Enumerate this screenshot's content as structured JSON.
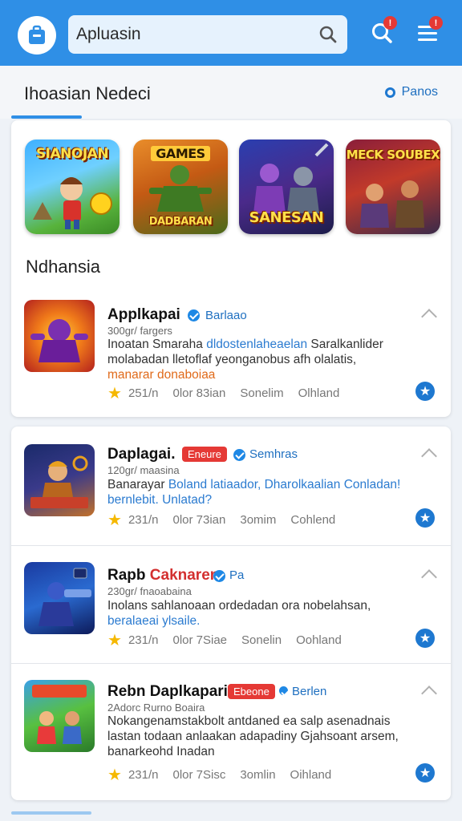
{
  "header": {
    "search_value": "Apluasin",
    "notification_badge": "!",
    "menu_badge": "!"
  },
  "section": {
    "title": "Ihoasian Nedeci",
    "link_label": "Panos",
    "subtitle": "Ndhansia"
  },
  "featured": [
    {
      "label": "SIANOJAN",
      "icon": "hero-game-art"
    },
    {
      "label": "GAMES",
      "icon": "soldier-game-art",
      "label2": "DADBARAN"
    },
    {
      "label": "SANESAN",
      "icon": "knights-game-art"
    },
    {
      "label": "MECK SOUBEX",
      "icon": "warriors-game-art"
    }
  ],
  "apps": [
    {
      "name": "Applkapai",
      "tag": "Barlaao",
      "pill": "",
      "meta": "300gr/ fargers",
      "desc_plain": "Inoatan Smaraha ",
      "desc_accent": "dldostenlaheaelan",
      "desc_rest": " Saralkanlider molabadan lletoflaf yeonganobus afh olalatis,",
      "desc_orange": "manarar donaboiaa",
      "rating": "251/n",
      "stat2": "0lor 83ian",
      "stat3": "Sonelim",
      "stat4": "Olhland"
    },
    {
      "name": "Daplagai.",
      "tag": "Semhras",
      "pill": "Eneure",
      "meta": "120gr/ maasina",
      "desc_plain": "Banarayar ",
      "desc_accent": "Boland latiaador, Dharolkaalian Conladan! bernlebit. Unlatad?",
      "desc_rest": "",
      "desc_orange": "",
      "rating": "231/n",
      "stat2": "0lor 73ian",
      "stat3": "3omim",
      "stat4": "Cohlend"
    },
    {
      "name": "Rapb",
      "name_red": "Caknaren",
      "tag": "Pa",
      "pill": "",
      "meta": "230gr/ fnaoabaina",
      "desc_plain": "Inolans sahlanoaan ordedadan ora nobelahsan,",
      "desc_accent": "",
      "desc_rest": "",
      "desc_orange": "",
      "desc_line2": "beralaeai ylsaile.",
      "rating": "231/n",
      "stat2": "0lor 7Siae",
      "stat3": "Sonelin",
      "stat4": "Oohland"
    },
    {
      "name": "Rebn Daplkapari.",
      "tag": "Berlen",
      "pill": "Ebeone",
      "meta": "2Adorc Rurno Boaira",
      "desc_plain": "Nokangenamstakbolt antdaned ea salp asenadnais lastan todaan anlaakan adapadiny Gjahsoant arsem, banarkeohd Inadan",
      "desc_accent": "",
      "desc_rest": "",
      "desc_orange": "",
      "rating": "231/n",
      "stat2": "0lor 7Sisc",
      "stat3": "3omlin",
      "stat4": "Oihland"
    }
  ],
  "colors": {
    "header_bg": "#2f8fe6",
    "accent": "#1e78d0",
    "badge": "#e53935",
    "star": "#f5b800"
  }
}
